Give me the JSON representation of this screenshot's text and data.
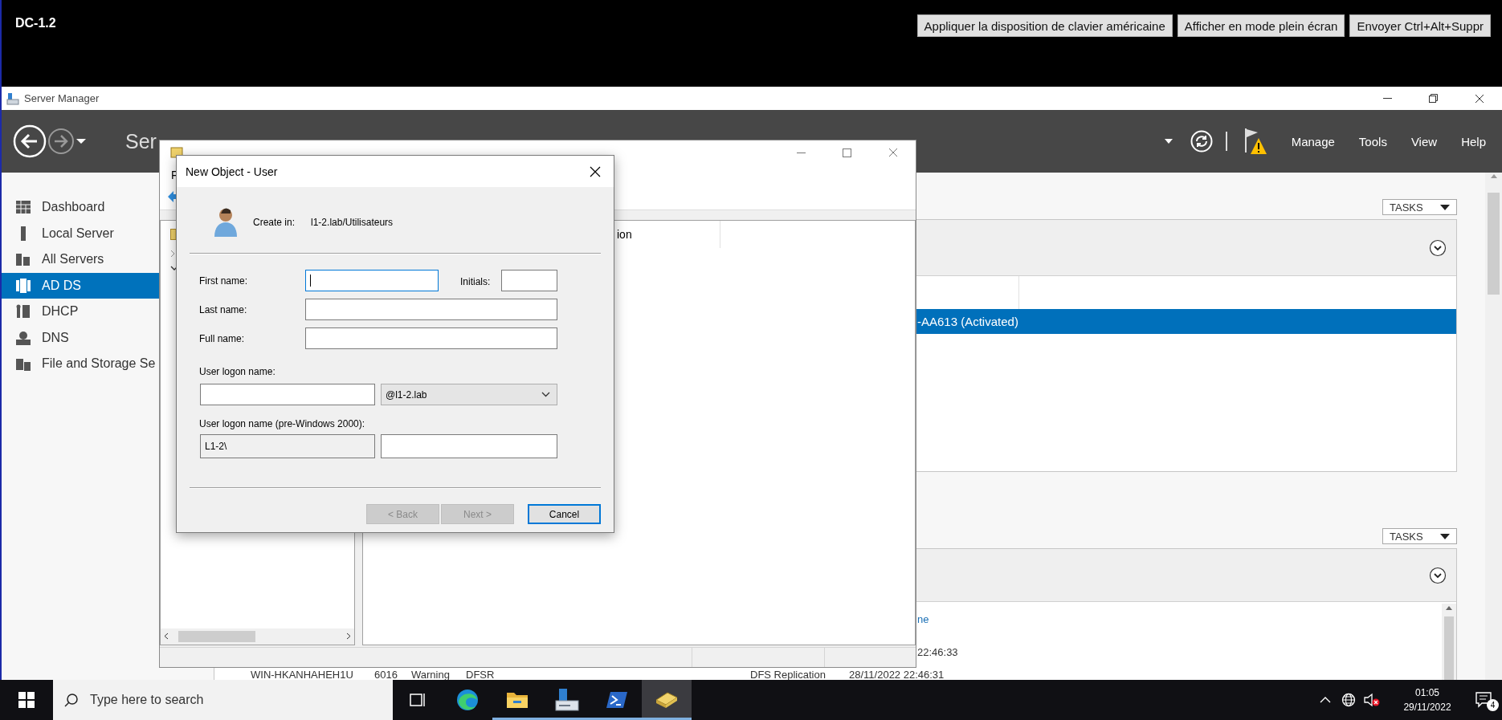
{
  "rdp_bar": {
    "title": "DC-1.2",
    "buttons": [
      "Appliquer la disposition de clavier américaine",
      "Afficher en mode plein écran",
      "Envoyer Ctrl+Alt+Suppr"
    ]
  },
  "server_manager": {
    "title": "Server Manager",
    "header_title": "Ser",
    "menu": [
      "Manage",
      "Tools",
      "View",
      "Help"
    ],
    "sidebar": [
      {
        "kind": "dashboard",
        "label": "Dashboard",
        "selected": false
      },
      {
        "kind": "server",
        "label": "Local Server",
        "selected": false
      },
      {
        "kind": "servers",
        "label": "All Servers",
        "selected": false
      },
      {
        "kind": "adds",
        "label": "AD DS",
        "selected": true
      },
      {
        "kind": "dhcp",
        "label": "DHCP",
        "selected": false
      },
      {
        "kind": "dns",
        "label": "DNS",
        "selected": false
      },
      {
        "kind": "storage",
        "label": "File and Storage Se",
        "selected": false
      }
    ],
    "servers_panel": {
      "tasks": "TASKS",
      "rows": [
        {
          "text": "-AA613 (Activated)",
          "selected": true
        }
      ]
    },
    "events_panel": {
      "tasks": "TASKS",
      "column": "ne",
      "partial_time": "22:46:33",
      "event": [
        "WIN-HKANHAHEH1U",
        "6016",
        "Warning",
        "DFSR",
        "DFS Replication",
        "28/11/2022 22:46:31"
      ]
    }
  },
  "aduc": {
    "menu": "F",
    "column": "ion"
  },
  "dialog": {
    "title": "New Object - User",
    "create_in_label": "Create in:",
    "create_in": "l1-2.lab/Utilisateurs",
    "name_fields": [
      {
        "label": "First name:",
        "focused": true
      },
      {
        "label": "Initials:",
        "focused": false
      },
      {
        "label": "Last name:",
        "focused": false
      },
      {
        "label": "Full name:",
        "focused": false
      }
    ],
    "logon_label": "User logon name:",
    "domain": "@l1-2.lab",
    "pre2000_label": "User logon name (pre-Windows 2000):",
    "pre2000_prefix": "L1-2\\",
    "buttons": [
      {
        "label": "< Back",
        "disabled": true,
        "default": false
      },
      {
        "label": "Next >",
        "disabled": true,
        "default": false
      },
      {
        "label": "Cancel",
        "disabled": false,
        "default": true
      }
    ]
  },
  "taskbar": {
    "search_placeholder": "Type here to search",
    "apps": [
      {
        "kind": "task-view",
        "running": false,
        "selected": false
      },
      {
        "kind": "edge",
        "running": false,
        "selected": false
      },
      {
        "kind": "explorer",
        "running": true,
        "selected": false
      },
      {
        "kind": "server-manager",
        "running": true,
        "selected": false
      },
      {
        "kind": "powershell",
        "running": true,
        "selected": false
      },
      {
        "kind": "aduc",
        "running": true,
        "selected": true
      }
    ],
    "time": "01:05",
    "date": "29/11/2022",
    "notifications": "4"
  }
}
